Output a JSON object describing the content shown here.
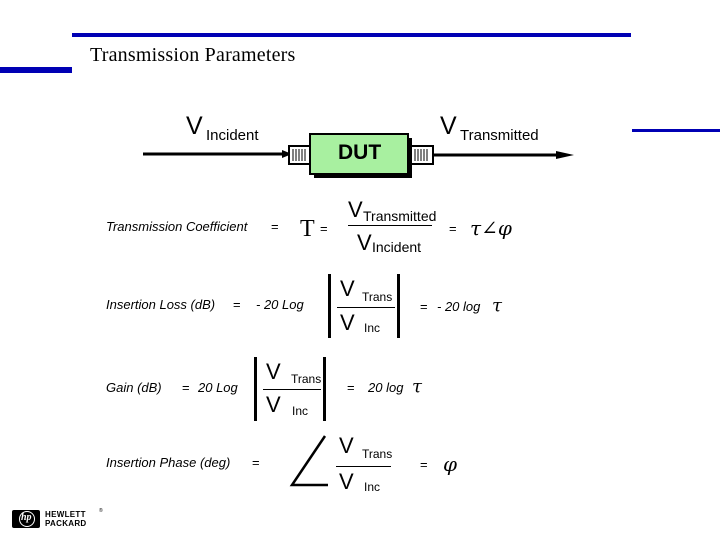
{
  "slide": {
    "title": "Transmission Parameters",
    "accent_color": "#0000b4"
  },
  "diagram": {
    "v_symbol": "V",
    "incident_label": "Incident",
    "transmitted_label": "Transmitted",
    "dut_label": "DUT",
    "dut_color": "#a8f0a0"
  },
  "equations": {
    "transmission_coefficient": {
      "label": "Transmission Coefficient",
      "equals": "=",
      "symbol": "T",
      "numerator_v": "V",
      "numerator_sub": "Transmitted",
      "denominator_v": "V",
      "denominator_sub": "Incident",
      "result": "τ∠φ"
    },
    "insertion_loss": {
      "label": "Insertion Loss (dB)",
      "equals": "=",
      "prefix": "- 20 Log",
      "numerator_v": "V",
      "numerator_sub": "Trans",
      "denominator_v": "V",
      "denominator_sub": "Inc",
      "result": "- 20 log",
      "result_symbol": "τ"
    },
    "gain": {
      "label": "Gain  (dB)",
      "equals": "=",
      "prefix": "20 Log",
      "numerator_v": "V",
      "numerator_sub": "Trans",
      "denominator_v": "V",
      "denominator_sub": "Inc",
      "result": "20 log",
      "result_symbol": "τ"
    },
    "insertion_phase": {
      "label": "Insertion Phase (deg)",
      "equals": "=",
      "numerator_v": "V",
      "numerator_sub": "Trans",
      "denominator_v": "V",
      "denominator_sub": "Inc",
      "result_symbol": "φ"
    }
  },
  "logo": {
    "mark": "hp",
    "line1": "HEWLETT",
    "line2": "PACKARD",
    "registered": "®"
  }
}
